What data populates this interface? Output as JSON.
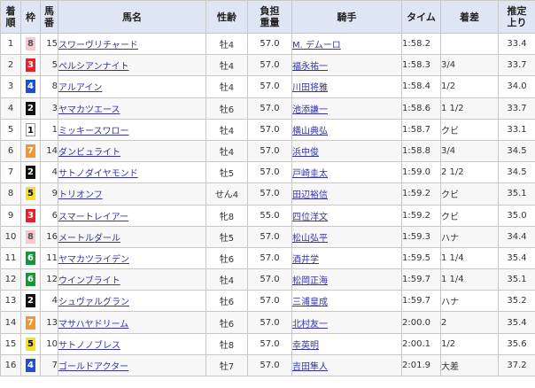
{
  "headers": {
    "finish": "着\n順",
    "waku": "枠",
    "umaban": "馬\n番",
    "horse": "馬名",
    "sex_age": "性齢",
    "weight": "負担\n重量",
    "jockey": "騎手",
    "time": "タイム",
    "margin": "着差",
    "last3f": "推定\n上り"
  },
  "colors": {
    "waku_1": "#ffffff",
    "waku_2": "#111111",
    "waku_3": "#e8202a",
    "waku_4": "#1f4fd8",
    "waku_5": "#f4e21a",
    "waku_6": "#17953a",
    "waku_7": "#f2962e",
    "waku_8": "#f6c9d1",
    "link": "#3333aa",
    "header_bg": "#dfe6f3"
  },
  "rows": [
    {
      "finish": "1",
      "waku": "8",
      "umaban": "15",
      "horse": "スワーヴリチャード",
      "sex_age": "牡4",
      "weight": "57.0",
      "jockey": "M. デムーロ",
      "time": "1:58.2",
      "margin": "",
      "last3f": "33.4"
    },
    {
      "finish": "2",
      "waku": "3",
      "umaban": "5",
      "horse": "ペルシアンナイト",
      "sex_age": "牡4",
      "weight": "57.0",
      "jockey": "福永祐一",
      "time": "1:58.3",
      "margin": "3/4",
      "last3f": "33.7"
    },
    {
      "finish": "3",
      "waku": "4",
      "umaban": "8",
      "horse": "アルアイン",
      "sex_age": "牡4",
      "weight": "57.0",
      "jockey": "川田将雅",
      "time": "1:58.4",
      "margin": "1/2",
      "last3f": "34.0"
    },
    {
      "finish": "4",
      "waku": "2",
      "umaban": "3",
      "horse": "ヤマカツエース",
      "sex_age": "牡6",
      "weight": "57.0",
      "jockey": "池添謙一",
      "time": "1:58.6",
      "margin": "1 1/2",
      "last3f": "33.7"
    },
    {
      "finish": "5",
      "waku": "1",
      "umaban": "1",
      "horse": "ミッキースワロー",
      "sex_age": "牡4",
      "weight": "57.0",
      "jockey": "横山典弘",
      "time": "1:58.7",
      "margin": "クビ",
      "last3f": "33.1"
    },
    {
      "finish": "6",
      "waku": "7",
      "umaban": "14",
      "horse": "ダンビュライト",
      "sex_age": "牡4",
      "weight": "57.0",
      "jockey": "浜中俊",
      "time": "1:58.8",
      "margin": "3/4",
      "last3f": "34.5"
    },
    {
      "finish": "7",
      "waku": "2",
      "umaban": "4",
      "horse": "サトノダイヤモンド",
      "sex_age": "牡5",
      "weight": "57.0",
      "jockey": "戸崎圭太",
      "time": "1:59.0",
      "margin": "2 1/2",
      "last3f": "34.5"
    },
    {
      "finish": "8",
      "waku": "5",
      "umaban": "9",
      "horse": "トリオンフ",
      "sex_age": "せん4",
      "weight": "57.0",
      "jockey": "田辺裕信",
      "time": "1:59.2",
      "margin": "クビ",
      "last3f": "35.1"
    },
    {
      "finish": "9",
      "waku": "3",
      "umaban": "6",
      "horse": "スマートレイアー",
      "sex_age": "牝8",
      "weight": "55.0",
      "jockey": "四位洋文",
      "time": "1:59.2",
      "margin": "クビ",
      "last3f": "35.0"
    },
    {
      "finish": "10",
      "waku": "8",
      "umaban": "16",
      "horse": "メートルダール",
      "sex_age": "牡5",
      "weight": "57.0",
      "jockey": "松山弘平",
      "time": "1:59.3",
      "margin": "ハナ",
      "last3f": "34.4"
    },
    {
      "finish": "11",
      "waku": "6",
      "umaban": "11",
      "horse": "ヤマカツライデン",
      "sex_age": "牡6",
      "weight": "57.0",
      "jockey": "酒井学",
      "time": "1:59.5",
      "margin": "1 1/4",
      "last3f": "35.4"
    },
    {
      "finish": "12",
      "waku": "6",
      "umaban": "12",
      "horse": "ウインブライト",
      "sex_age": "牡4",
      "weight": "57.0",
      "jockey": "松岡正海",
      "time": "1:59.7",
      "margin": "1 1/4",
      "last3f": "35.1"
    },
    {
      "finish": "13",
      "waku": "2",
      "umaban": "4",
      "horse": "シュヴァルグラン",
      "sex_age": "牡6",
      "weight": "57.0",
      "jockey": "三浦皇成",
      "time": "1:59.7",
      "margin": "ハナ",
      "last3f": "35.2"
    },
    {
      "finish": "14",
      "waku": "7",
      "umaban": "13",
      "horse": "マサハヤドリーム",
      "sex_age": "牡6",
      "weight": "57.0",
      "jockey": "北村友一",
      "time": "2:00.0",
      "margin": "2",
      "last3f": "35.4"
    },
    {
      "finish": "15",
      "waku": "5",
      "umaban": "10",
      "horse": "サトノノブレス",
      "sex_age": "牡8",
      "weight": "57.0",
      "jockey": "幸英明",
      "time": "2:00.1",
      "margin": "1/2",
      "last3f": "35.6"
    },
    {
      "finish": "16",
      "waku": "4",
      "umaban": "7",
      "horse": "ゴールドアクター",
      "sex_age": "牡7",
      "weight": "57.0",
      "jockey": "吉田隼人",
      "time": "2:01.9",
      "margin": "大差",
      "last3f": "37.2"
    }
  ]
}
